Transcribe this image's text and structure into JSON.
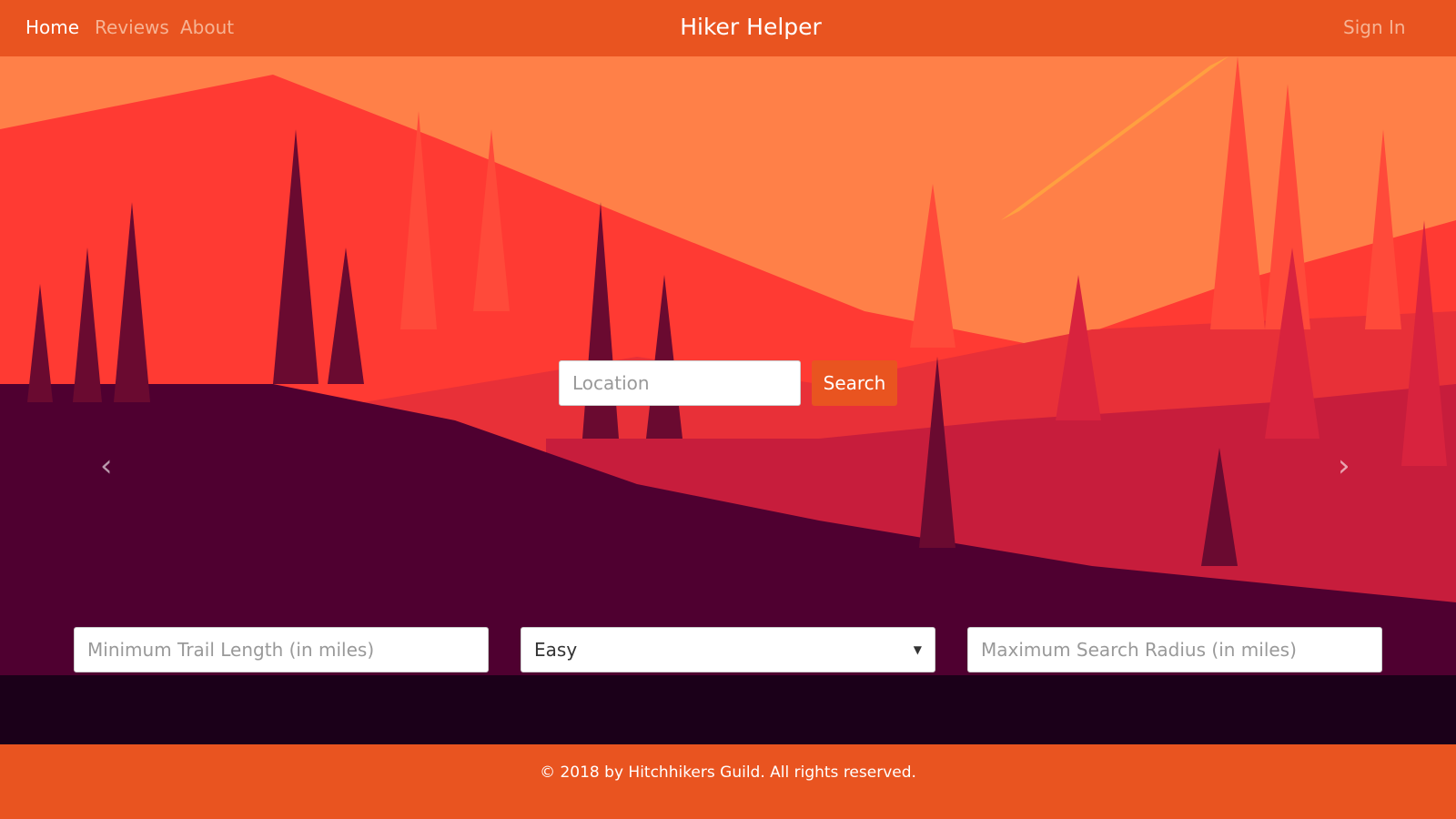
{
  "nav": {
    "links": [
      {
        "label": "Home",
        "active": true
      },
      {
        "label": "Reviews"
      },
      {
        "label": "About"
      }
    ],
    "brand": "Hiker Helper",
    "signin": "Sign In"
  },
  "search": {
    "location_placeholder": "Location",
    "button": "Search"
  },
  "filters": {
    "min_length_placeholder": "Minimum Trail Length (in miles)",
    "difficulty": "Easy",
    "max_radius_placeholder": "Maximum Search Radius (in miles)"
  },
  "carousel": {
    "prev_icon": "chevron-left-icon",
    "next_icon": "chevron-right-icon",
    "slides": 5,
    "active_slide": 5
  },
  "footer": {
    "text": "© 2018 by Hitchhikers Guild. All rights reserved."
  },
  "colors": {
    "brand": "#e95420"
  }
}
